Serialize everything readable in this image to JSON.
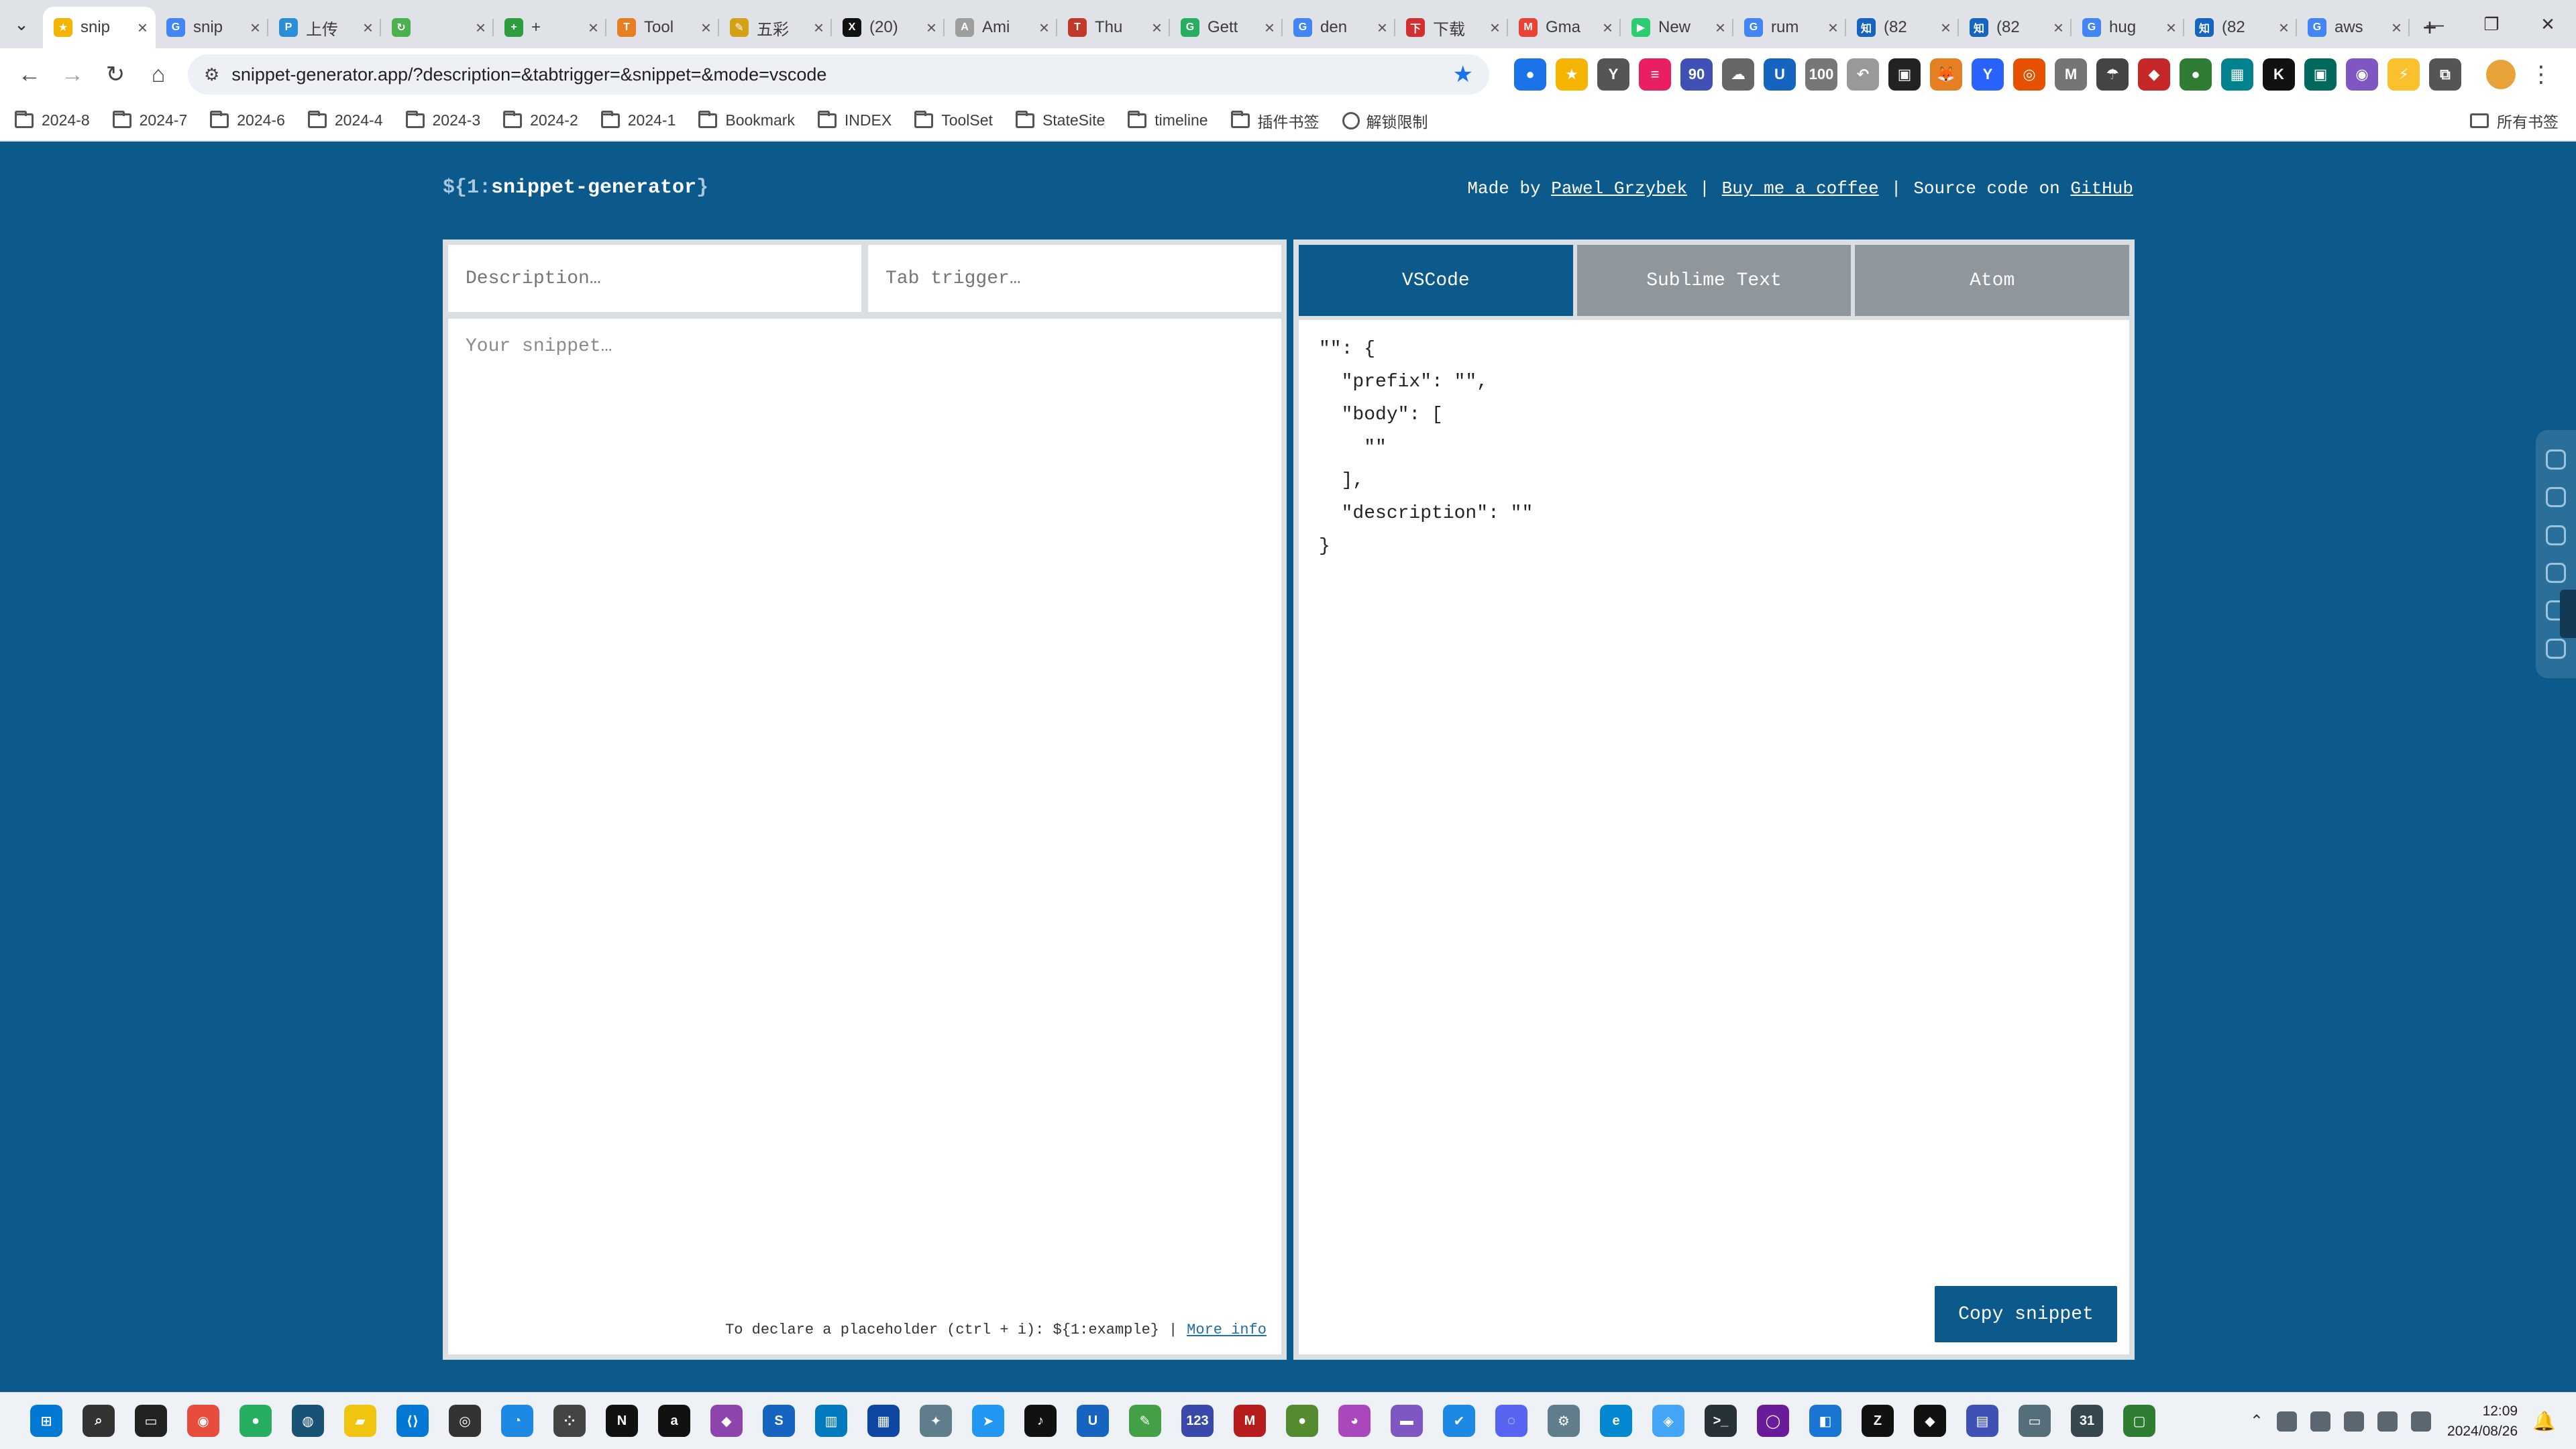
{
  "browser": {
    "tabs": [
      {
        "title": "snip",
        "color": "#f5b400",
        "glyph": "★",
        "active": true
      },
      {
        "title": "snip",
        "color": "#4285f4",
        "glyph": "G"
      },
      {
        "title": "上传",
        "color": "#2b8fd8",
        "glyph": "P"
      },
      {
        "title": "",
        "color": "#4caf50",
        "glyph": "↻"
      },
      {
        "title": "+",
        "color": "#2e9d3e",
        "glyph": "+"
      },
      {
        "title": "Tool",
        "color": "#e67e22",
        "glyph": "T"
      },
      {
        "title": "五彩",
        "color": "#d4a017",
        "glyph": "✎"
      },
      {
        "title": "(20)",
        "color": "#111111",
        "glyph": "X"
      },
      {
        "title": "Ami",
        "color": "#9e9e9e",
        "glyph": "A"
      },
      {
        "title": "Thu",
        "color": "#c0392b",
        "glyph": "T"
      },
      {
        "title": "Gett",
        "color": "#27ae60",
        "glyph": "G"
      },
      {
        "title": "den",
        "color": "#4285f4",
        "glyph": "G"
      },
      {
        "title": "下载",
        "color": "#d32f2f",
        "glyph": "下"
      },
      {
        "title": "Gma",
        "color": "#ea4335",
        "glyph": "M"
      },
      {
        "title": "New",
        "color": "#2ecc71",
        "glyph": "▶"
      },
      {
        "title": "rum",
        "color": "#4285f4",
        "glyph": "G"
      },
      {
        "title": "(82",
        "color": "#1565c0",
        "glyph": "知"
      },
      {
        "title": "(82",
        "color": "#1565c0",
        "glyph": "知"
      },
      {
        "title": "hug",
        "color": "#4285f4",
        "glyph": "G"
      },
      {
        "title": "(82",
        "color": "#1565c0",
        "glyph": "知"
      },
      {
        "title": "aws",
        "color": "#4285f4",
        "glyph": "G"
      }
    ],
    "url": "snippet-generator.app/?description=&tabtrigger=&snippet=&mode=vscode",
    "bookmarks": [
      "2024-8",
      "2024-7",
      "2024-6",
      "2024-4",
      "2024-3",
      "2024-2",
      "2024-1",
      "Bookmark",
      "INDEX",
      "ToolSet",
      "StateSite",
      "timeline",
      "插件书签"
    ],
    "bookmark_special": "解锁限制",
    "bookmark_all": "所有书签",
    "extensions": [
      {
        "color": "#1a73e8",
        "glyph": "●"
      },
      {
        "color": "#f5b400",
        "glyph": "★"
      },
      {
        "color": "#555555",
        "glyph": "Y"
      },
      {
        "color": "#e91e63",
        "glyph": "≡"
      },
      {
        "color": "#3f51b5",
        "glyph": "90"
      },
      {
        "color": "#666666",
        "glyph": "☁"
      },
      {
        "color": "#1565c0",
        "glyph": "U"
      },
      {
        "color": "#777777",
        "glyph": "100"
      },
      {
        "color": "#999999",
        "glyph": "↶"
      },
      {
        "color": "#222222",
        "glyph": "▣"
      },
      {
        "color": "#e67e22",
        "glyph": "🦊"
      },
      {
        "color": "#2962ff",
        "glyph": "Y"
      },
      {
        "color": "#e65100",
        "glyph": "◎"
      },
      {
        "color": "#757575",
        "glyph": "M"
      },
      {
        "color": "#444444",
        "glyph": "☂"
      },
      {
        "color": "#c62828",
        "glyph": "◆"
      },
      {
        "color": "#2e7d32",
        "glyph": "●"
      },
      {
        "color": "#00838f",
        "glyph": "▦"
      },
      {
        "color": "#111111",
        "glyph": "K"
      },
      {
        "color": "#00695c",
        "glyph": "▣"
      },
      {
        "color": "#7e57c2",
        "glyph": "◉"
      },
      {
        "color": "#fbc02d",
        "glyph": "⚡"
      },
      {
        "color": "#555555",
        "glyph": "⧉"
      }
    ]
  },
  "app": {
    "logo_prefix": "${1:",
    "logo_name": "snippet-generator",
    "logo_suffix": "}",
    "credits": {
      "made_by_label": "Made by",
      "author": "Pawel Grzybek",
      "coffee": "Buy me a coffee",
      "source_label": "Source code on",
      "source_link": "GitHub"
    },
    "description_placeholder": "Description…",
    "tabtrigger_placeholder": "Tab trigger…",
    "snippet_placeholder": "Your snippet…",
    "footer_hint": "To declare a placeholder (ctrl + i): ${1:example}",
    "footer_link": "More info",
    "modes": [
      "VSCode",
      "Sublime Text",
      "Atom"
    ],
    "active_mode": "VSCode",
    "output_lines": [
      "\"\": {",
      "  \"prefix\": \"\",",
      "  \"body\": [",
      "    \"\"",
      "  ],",
      "  \"description\": \"\"",
      "}"
    ],
    "copy_label": "Copy snippet"
  },
  "taskbar": {
    "apps": [
      {
        "color": "#0078d4",
        "glyph": "⊞"
      },
      {
        "color": "#333333",
        "glyph": "⌕"
      },
      {
        "color": "#222222",
        "glyph": "▭"
      },
      {
        "color": "#e74c3c",
        "glyph": "◉"
      },
      {
        "color": "#27ae60",
        "glyph": "●"
      },
      {
        "color": "#1a5276",
        "glyph": "◍"
      },
      {
        "color": "#f1c40f",
        "glyph": "▰"
      },
      {
        "color": "#0078d4",
        "glyph": "⟨⟩"
      },
      {
        "color": "#333333",
        "glyph": "◎"
      },
      {
        "color": "#1e88e5",
        "glyph": "◔"
      },
      {
        "color": "#444444",
        "glyph": "⁘"
      },
      {
        "color": "#111111",
        "glyph": "N"
      },
      {
        "color": "#111111",
        "glyph": "a"
      },
      {
        "color": "#8e44ad",
        "glyph": "◆"
      },
      {
        "color": "#1565c0",
        "glyph": "S"
      },
      {
        "color": "#0079bf",
        "glyph": "▥"
      },
      {
        "color": "#0d47a1",
        "glyph": "▦"
      },
      {
        "color": "#607d8b",
        "glyph": "✦"
      },
      {
        "color": "#2196f3",
        "glyph": "➤"
      },
      {
        "color": "#111111",
        "glyph": "♪"
      },
      {
        "color": "#1565c0",
        "glyph": "U"
      },
      {
        "color": "#43a047",
        "glyph": "✎"
      },
      {
        "color": "#3949ab",
        "glyph": "123"
      },
      {
        "color": "#b71c1c",
        "glyph": "M"
      },
      {
        "color": "#558b2f",
        "glyph": "●"
      },
      {
        "color": "#ab47bc",
        "glyph": "◕"
      },
      {
        "color": "#7e57c2",
        "glyph": "▬"
      },
      {
        "color": "#1e88e5",
        "glyph": "✔"
      },
      {
        "color": "#5865f2",
        "glyph": "◌"
      },
      {
        "color": "#607d8b",
        "glyph": "⚙"
      },
      {
        "color": "#0288d1",
        "glyph": "e"
      },
      {
        "color": "#42a5f5",
        "glyph": "◈"
      },
      {
        "color": "#263238",
        "glyph": ">_"
      },
      {
        "color": "#6a1b9a",
        "glyph": "◯"
      },
      {
        "color": "#1976d2",
        "glyph": "◧"
      },
      {
        "color": "#111111",
        "glyph": "Z"
      },
      {
        "color": "#111111",
        "glyph": "◆"
      },
      {
        "color": "#3f51b5",
        "glyph": "▤"
      },
      {
        "color": "#546e7a",
        "glyph": "▭"
      },
      {
        "color": "#37474f",
        "glyph": "31"
      },
      {
        "color": "#2e7d32",
        "glyph": "▢"
      }
    ],
    "time": "12:09",
    "date": "2024/08/26"
  }
}
